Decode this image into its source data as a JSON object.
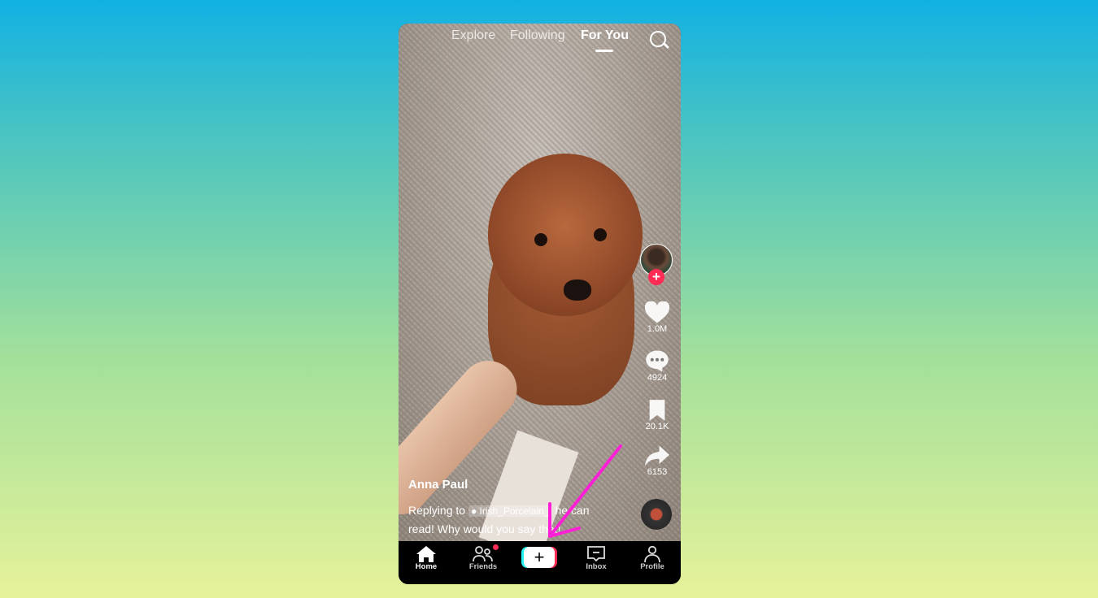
{
  "top_nav": {
    "tabs": [
      {
        "label": "Explore"
      },
      {
        "label": "Following"
      },
      {
        "label": "For You",
        "active": true
      }
    ],
    "search_icon": "search-icon"
  },
  "video": {
    "author": "Anna Paul",
    "caption_prefix": "Replying to",
    "mention": "Irish_Porcelain_",
    "caption_text": " he can read! Why would you say that!"
  },
  "actions": {
    "likes": "1.0M",
    "comments": "4924",
    "saves": "20.1K",
    "shares": "6153"
  },
  "bottom_nav": {
    "items": [
      {
        "label": "Home",
        "active": true
      },
      {
        "label": "Friends",
        "badge": true
      },
      {
        "label": "Create"
      },
      {
        "label": "Inbox"
      },
      {
        "label": "Profile"
      }
    ]
  },
  "colors": {
    "accent": "#fe2c55",
    "cyan": "#25f4ee",
    "annotation_arrow": "#ff1fd6"
  }
}
